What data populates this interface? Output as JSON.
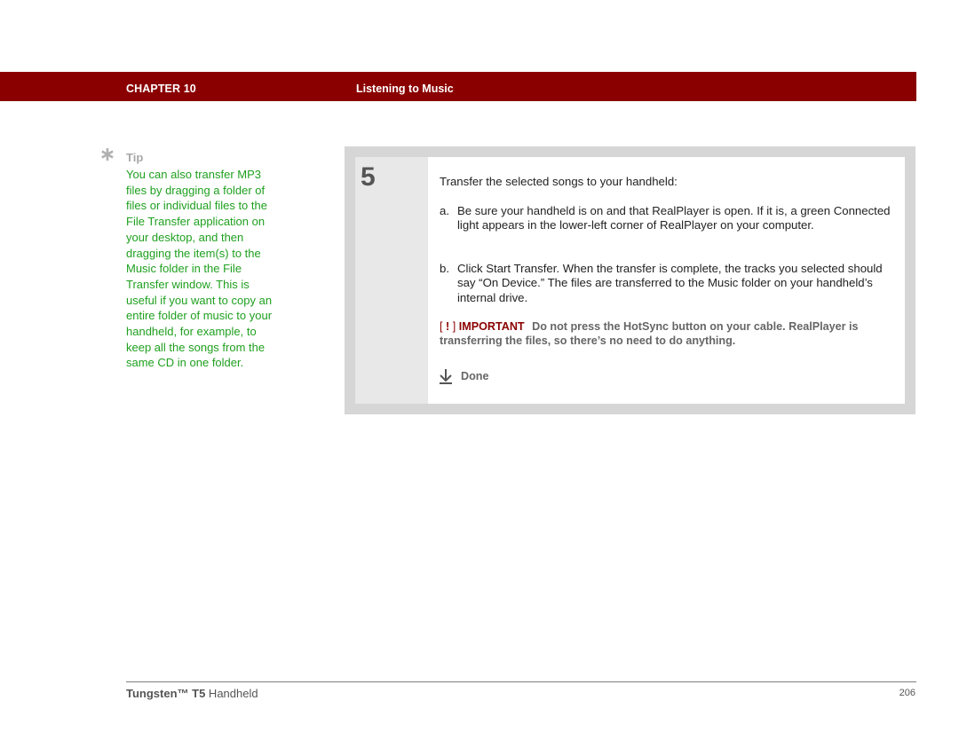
{
  "header": {
    "chapter": "CHAPTER 10",
    "title": "Listening to Music",
    "band_color": "#8a0000"
  },
  "sidebar": {
    "tip_icon": "asterisk-icon",
    "tip_label": "Tip",
    "tip_text": "You can also transfer MP3 files by dragging a folder of files or individual files to the File Transfer application on your desktop, and then dragging the item(s) to the Music folder in the File Transfer window. This is useful if you want to copy an entire folder of music to your handheld, for example, to keep all the songs from the same CD in one folder.",
    "tip_color": "#1fa01f"
  },
  "step": {
    "number": "5",
    "text": "Transfer the selected songs to your handheld:",
    "substeps": [
      {
        "letter": "a.",
        "text": "Be sure your handheld is on and that RealPlayer is open. If it is, a green Connected light appears in the lower-left corner of RealPlayer on your computer."
      },
      {
        "letter": "b.",
        "text": "Click Start Transfer. When the transfer is complete, the tracks you selected should say “On Device.” The files are transferred to the Music folder on your handheld’s internal drive."
      }
    ],
    "important": {
      "bracket_open": "[",
      "bang": "!",
      "bracket_close": "]",
      "label": "IMPORTANT",
      "text": "Do not press the HotSync button on your cable. RealPlayer is transferring the files, so there’s no need to do anything."
    },
    "done_icon": "down-arrow-icon",
    "done_label": "Done"
  },
  "footer": {
    "product_bold": "Tungsten™ T5",
    "product_rest": " Handheld",
    "page_number": "206"
  }
}
